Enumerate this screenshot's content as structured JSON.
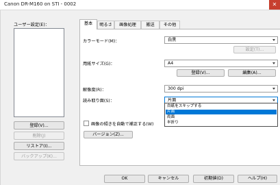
{
  "window": {
    "title": "Canon DR-M160 on STI - 0002",
    "close_glyph": "✕"
  },
  "left": {
    "user_settings_label": "ユーザー設定(E)：",
    "buttons": {
      "register": "登録(V)...",
      "delete": "削除(J)",
      "restore": "リストア(I)...",
      "backup": "バックアップ(K)..."
    }
  },
  "tabs": [
    "基本",
    "明るさ",
    "画像処理",
    "搬送",
    "その他"
  ],
  "basic": {
    "color_mode_label": "カラーモード(M)：",
    "color_mode_value": "白黒",
    "settings_button": "設定(T)...",
    "paper_size_label": "用紙サイズ(G)：",
    "paper_size_value": "A4",
    "register_button": "登録(V)...",
    "edit_button": "編集(A)...",
    "resolution_label": "解像度(R)：",
    "resolution_value": "300 dpi",
    "scan_side_label": "読み取り面(S)：",
    "scan_side_value": "片面",
    "scan_side_options": [
      "白紙をスキップする",
      "片面",
      "両面",
      "半折り"
    ],
    "scan_side_selected_index": 1,
    "deskew_label": "画像の傾きを自動で補正する(W)",
    "version_button": "バージョン(Z)..."
  },
  "footer": {
    "ok": "OK",
    "cancel": "キャンセル",
    "defaults": "初期値(D)",
    "help": "ヘルプ(H)"
  }
}
